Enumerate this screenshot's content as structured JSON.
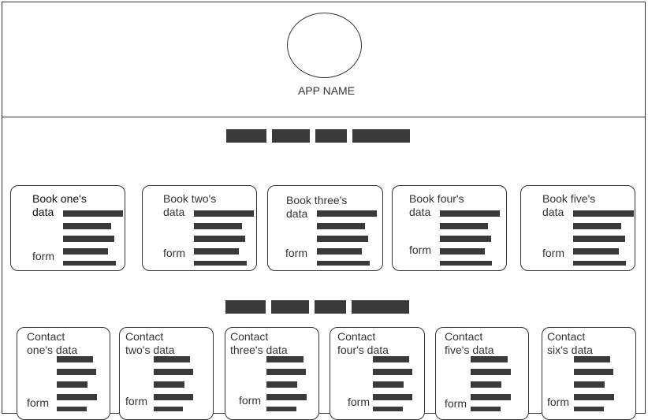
{
  "header": {
    "app_name": "APP NAME"
  },
  "books_section": {
    "nav_items": 4,
    "cards": [
      {
        "title": "Book one's\ndata",
        "form_label": "form"
      },
      {
        "title": "Book two's\ndata",
        "form_label": "form"
      },
      {
        "title": "Book three's\ndata",
        "form_label": "form"
      },
      {
        "title": "Book four's\ndata",
        "form_label": "form"
      },
      {
        "title": "Book five's\ndata",
        "form_label": "form"
      }
    ]
  },
  "contacts_section": {
    "nav_items": 4,
    "cards": [
      {
        "title": "Contact\none's data",
        "form_label": "form"
      },
      {
        "title": "Contact\ntwo's data",
        "form_label": "form"
      },
      {
        "title": "Contact\nthree's data",
        "form_label": "form"
      },
      {
        "title": "Contact\nfour's data",
        "form_label": "form"
      },
      {
        "title": "Contact\nfive's data",
        "form_label": "form"
      },
      {
        "title": "Contact\nsix's data",
        "form_label": "form"
      }
    ]
  },
  "colors": {
    "stroke": "#333333",
    "placeholder_bar": "#3a3a3a",
    "background": "#ffffff"
  }
}
